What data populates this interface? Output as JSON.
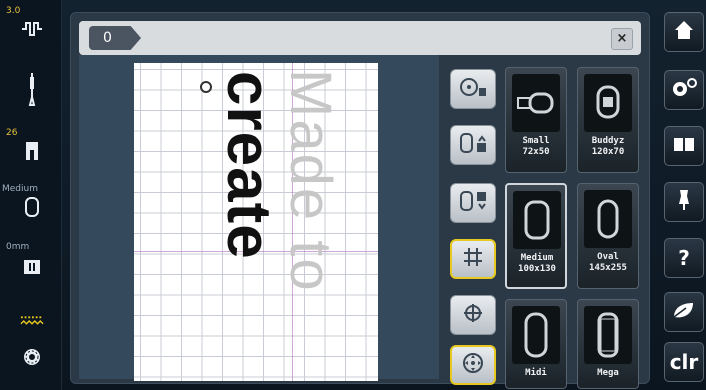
{
  "left_bar": {
    "stitch_length": "3.0",
    "presser_foot_value": "26",
    "hoop_label": "Medium",
    "needle_pos_label": "0mm"
  },
  "top_bar": {
    "tag_label": "0",
    "close_label": "×"
  },
  "canvas": {
    "design_text_light": "Made to",
    "design_text_dark": "create"
  },
  "hoops": [
    {
      "name": "Small",
      "size": "72x50"
    },
    {
      "name": "Buddyz",
      "size": "120x70"
    },
    {
      "name": "Medium",
      "size": "100x130"
    },
    {
      "name": "Oval",
      "size": "145x255"
    },
    {
      "name": "Midi",
      "size": ""
    },
    {
      "name": "Mega",
      "size": ""
    }
  ],
  "right_bar": {
    "clr_label": "clr",
    "help_label": "?"
  },
  "colors": {
    "accent": "#e7c820",
    "panel": "#2b3947"
  }
}
